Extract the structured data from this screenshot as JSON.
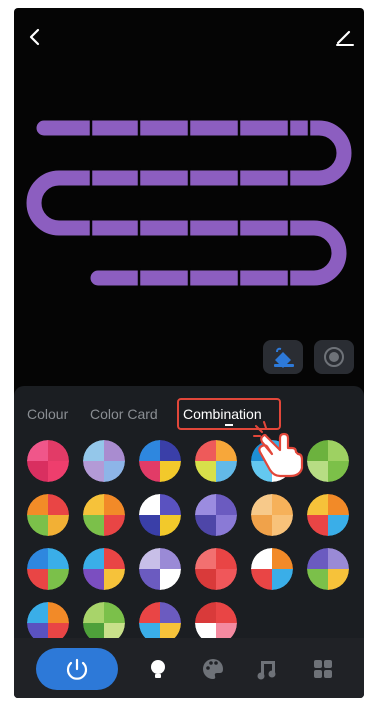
{
  "header": {
    "back_icon": "chevron-left-icon",
    "edit_icon": "pencil-icon"
  },
  "colors": {
    "strip": "#8c5ec0",
    "accent": "#2d79d8",
    "highlight": "#e2473a"
  },
  "tabs": [
    {
      "label": "Colour",
      "active": false
    },
    {
      "label": "Color Card",
      "active": false
    },
    {
      "label": "Combination",
      "active": true
    }
  ],
  "mode_buttons": [
    {
      "icon": "paint-bucket-icon",
      "active": true
    },
    {
      "icon": "circle-target-icon",
      "active": false
    }
  ],
  "swatches": [
    [
      "#e23b67",
      "#ee3e6d",
      "#d92f60",
      "#f0568a"
    ],
    [
      "#a98cd0",
      "#8db5e8",
      "#b39ad6",
      "#94c7ea"
    ],
    [
      "#3a3fa8",
      "#f2c92b",
      "#e23b67",
      "#2e87df"
    ],
    [
      "#f7a73a",
      "#62b9e8",
      "#d8e04a",
      "#ee5a5a"
    ],
    [
      "#3aaee8",
      "#ffffff",
      "#64c8f0",
      "#1e8fd6"
    ],
    [
      "#9ed162",
      "#7cc049",
      "#b7dd84",
      "#6cb23e"
    ],
    [
      "#e94545",
      "#f2b035",
      "#7bc04a",
      "#f28c28"
    ],
    [
      "#f28a28",
      "#e94545",
      "#7bc04a",
      "#f6c23a"
    ],
    [
      "#5a52c0",
      "#f2c92b",
      "#3a3fa8",
      "#ffffff"
    ],
    [
      "#6b5bc0",
      "#8a7ad6",
      "#4e46a8",
      "#9b8ce0"
    ],
    [
      "#f6b15a",
      "#f8c27a",
      "#f0a24a",
      "#f7c98a"
    ],
    [
      "#f28a28",
      "#3aaee8",
      "#e94545",
      "#f6c23a"
    ],
    [
      "#3aaee8",
      "#7bc04a",
      "#e94545",
      "#2e87df"
    ],
    [
      "#e94545",
      "#f6c23a",
      "#7b4ec0",
      "#3aaee8"
    ],
    [
      "#9a8ad6",
      "#ffffff",
      "#6b5bc0",
      "#c8bfe8"
    ],
    [
      "#e94545",
      "#f0575a",
      "#d93a3a",
      "#f27070"
    ],
    [
      "#f28a28",
      "#3aaee8",
      "#e94545",
      "#ffffff"
    ],
    [
      "#9a8ad6",
      "#f6c23a",
      "#7bc04a",
      "#6b5bc0"
    ],
    [
      "#f28a28",
      "#e94545",
      "#5a52c0",
      "#3aaee8"
    ],
    [
      "#7bc04a",
      "#c8e08a",
      "#4ea03a",
      "#a8d46a"
    ],
    [
      "#6b5bc0",
      "#f6c23a",
      "#3aaee8",
      "#e94545"
    ],
    [
      "#e94545",
      "#f48aa0",
      "#ffffff",
      "#d93a3a"
    ]
  ],
  "bottom_nav": [
    {
      "icon": "power-icon",
      "active": true
    },
    {
      "icon": "bulb-icon",
      "active": false
    },
    {
      "icon": "palette-icon",
      "active": false
    },
    {
      "icon": "music-icon",
      "active": false
    },
    {
      "icon": "grid-icon",
      "active": false
    }
  ]
}
